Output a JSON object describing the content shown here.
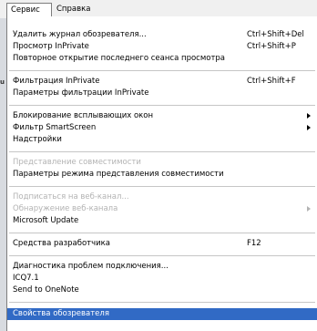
{
  "menubar": {
    "items": [
      {
        "label": "Сервис"
      },
      {
        "label": "Справка"
      }
    ]
  },
  "left_strip": {
    "text": "u"
  },
  "menu": {
    "items": [
      {
        "label": "Удалить журнал обозревателя...",
        "shortcut": "Ctrl+Shift+Del"
      },
      {
        "label": "Просмотр InPrivate",
        "shortcut": "Ctrl+Shift+P"
      },
      {
        "label": "Повторное открытие последнего сеанса просмотра",
        "shortcut": ""
      },
      {
        "label": "Фильтрация InPrivate",
        "shortcut": "Ctrl+Shift+F"
      },
      {
        "label": "Параметры фильтрации InPrivate",
        "shortcut": ""
      },
      {
        "label": "Блокирование всплывающих окон",
        "shortcut": "",
        "submenu": true
      },
      {
        "label": "Фильтр SmartScreen",
        "shortcut": "",
        "submenu": true
      },
      {
        "label": "Надстройки",
        "shortcut": ""
      },
      {
        "label": "Представление совместимости",
        "shortcut": "",
        "disabled": true
      },
      {
        "label": "Параметры режима представления совместимости",
        "shortcut": ""
      },
      {
        "label": "Подписаться на веб-канал...",
        "shortcut": "",
        "disabled": true
      },
      {
        "label": "Обнаружение веб-канала",
        "shortcut": "",
        "disabled": true,
        "submenu": true
      },
      {
        "label": "Microsoft Update",
        "shortcut": ""
      },
      {
        "label": "Средства разработчика",
        "shortcut": "F12"
      },
      {
        "label": "Диагностика проблем подключения...",
        "shortcut": ""
      },
      {
        "label": "ICQ7.1",
        "shortcut": ""
      },
      {
        "label": "Send to OneNote",
        "shortcut": ""
      },
      {
        "label": "Свойства обозревателя",
        "shortcut": "",
        "highlighted": true
      }
    ]
  },
  "colors": {
    "highlight": "#316ac5",
    "disabled_text": "#b3b3b3"
  }
}
